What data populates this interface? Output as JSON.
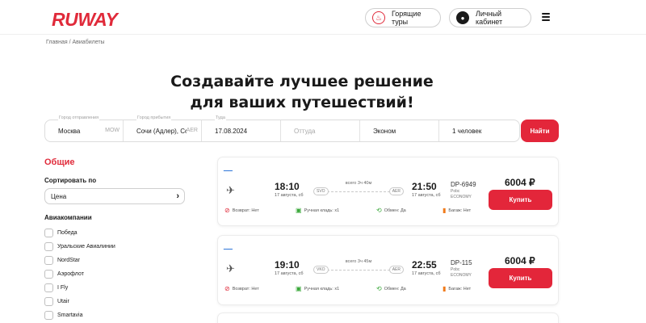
{
  "header": {
    "logo": "RUWAY",
    "hot_tours": "Горящие туры",
    "cabinet": "Личный кабинет"
  },
  "breadcrumb": {
    "home": "Главная",
    "sep": " / ",
    "current": "Авиабилеты"
  },
  "hero": {
    "line1": "Создавайте лучшее решение",
    "line2": "для ваших путешествий!"
  },
  "search": {
    "from": {
      "label": "Город отправления",
      "value": "Москва",
      "code": "MOW"
    },
    "to": {
      "label": "Город прибытия",
      "value": "Сочи (Адлер), Сочи",
      "code": "AER"
    },
    "depart": {
      "label": "Туда",
      "value": "17.08.2024"
    },
    "return": {
      "placeholder": "Оттуда"
    },
    "class": {
      "value": "Эконом"
    },
    "passengers": {
      "value": "1 человек"
    },
    "button": "Найти"
  },
  "sidebar": {
    "title": "Общие",
    "sort_label": "Сортировать по",
    "sort_value": "Цена",
    "airlines_label": "Авиакомпании",
    "airlines": [
      "Победа",
      "Уральские Авиалинии",
      "NordStar",
      "Аэрофлот",
      "I Fly",
      "Utair",
      "Smartavia"
    ]
  },
  "flights": [
    {
      "airline_logo": "pobeda",
      "dep_time": "18:10",
      "dep_date": "17 августа, сб",
      "duration": "всего 3ч 40м",
      "from": "SVO",
      "to": "AER",
      "arr_time": "21:50",
      "arr_date": "17 августа, сб",
      "flight_no": "DP-6949",
      "fare": "Pobc",
      "cabin": "ECONOMY",
      "price": "6004 ₽",
      "buy": "Купить",
      "refund": "Возврат: Нет",
      "hand": "Ручная кладь: x1",
      "exchange": "Обмен: Да",
      "baggage": "Багаж: Нет"
    },
    {
      "airline_logo": "pobeda",
      "dep_time": "19:10",
      "dep_date": "17 августа, сб",
      "duration": "всего 3ч 45м",
      "from": "VKO",
      "to": "AER",
      "arr_time": "22:55",
      "arr_date": "17 августа, сб",
      "flight_no": "DP-115",
      "fare": "Pobc",
      "cabin": "ECONOMY",
      "price": "6004 ₽",
      "buy": "Купить",
      "refund": "Возврат: Нет",
      "hand": "Ручная кладь: x1",
      "exchange": "Обмен: Да",
      "baggage": "Багаж: Нет"
    }
  ],
  "colors": {
    "accent": "#e3263a",
    "text": "#1a1a1a",
    "muted": "#a0a0a0"
  }
}
